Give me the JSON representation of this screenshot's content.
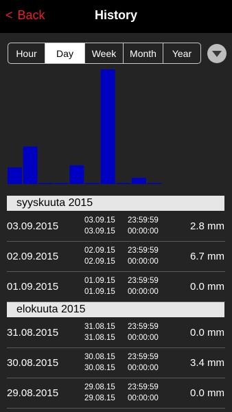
{
  "nav": {
    "back_chevron": "<",
    "back_label": "Back",
    "title": "History"
  },
  "tabs": [
    "Hour",
    "Day",
    "Week",
    "Month",
    "Year"
  ],
  "active_tab": "Day",
  "colors": {
    "bar": "#0000c0",
    "accent": "#e8202a"
  },
  "chart_data": {
    "type": "bar",
    "values": [
      1.6,
      3.6,
      0.0,
      0.0,
      1.8,
      0.0,
      11.0,
      0.0,
      0.6,
      0.0
    ],
    "ylim": [
      0,
      11.2
    ]
  },
  "sections": [
    {
      "title": "syyskuuta 2015",
      "rows": [
        {
          "date": "03.09.2015",
          "from_date": "03.09.15",
          "to_date": "03.09.15",
          "from_time": "23:59:59",
          "to_time": "00:00:00",
          "value": "2.8 mm"
        },
        {
          "date": "02.09.2015",
          "from_date": "02.09.15",
          "to_date": "02.09.15",
          "from_time": "23:59:59",
          "to_time": "00:00:00",
          "value": "6.7 mm"
        },
        {
          "date": "01.09.2015",
          "from_date": "01.09.15",
          "to_date": "01.09.15",
          "from_time": "23:59:59",
          "to_time": "00:00:00",
          "value": "0.0 mm"
        }
      ]
    },
    {
      "title": "elokuuta  2015",
      "rows": [
        {
          "date": "31.08.2015",
          "from_date": "31.08.15",
          "to_date": "31.08.15",
          "from_time": "23:59:59",
          "to_time": "00:00:00",
          "value": "0.0 mm"
        },
        {
          "date": "30.08.2015",
          "from_date": "30.08.15",
          "to_date": "30.08.15",
          "from_time": "23:59:59",
          "to_time": "00:00:00",
          "value": "3.4 mm"
        },
        {
          "date": "29.08.2015",
          "from_date": "29.08.15",
          "to_date": "29.08.15",
          "from_time": "23:59:59",
          "to_time": "00:00:00",
          "value": "0.0 mm"
        }
      ]
    }
  ]
}
